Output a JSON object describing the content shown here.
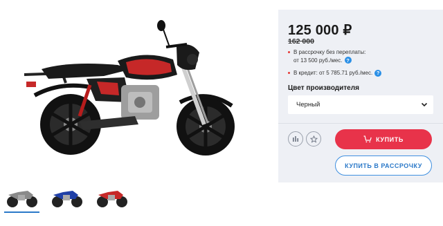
{
  "product": {
    "price": "125 000 ₽",
    "old_price": "162 000",
    "installment_line1": "В рассрочку без переплаты:",
    "installment_line2": "от 13 500 руб./мес.",
    "credit_text": "В кредит: от 5 785.71 руб./мес.",
    "help_symbol": "?",
    "color_label": "Цвет производителя",
    "color_selected": "Черный"
  },
  "actions": {
    "buy_label": "КУПИТЬ",
    "credit_label": "КУПИТЬ В РАССРОЧКУ",
    "compare_icon": "bar-chart-icon",
    "favorite_icon": "star-icon",
    "cart_icon": "cart-icon"
  },
  "gallery": {
    "main_image": "black-red-motorcycle",
    "thumbs": [
      {
        "image": "gray-motorcycle",
        "active": true
      },
      {
        "image": "blue-motorcycle",
        "active": false
      },
      {
        "image": "red-motorcycle",
        "active": false
      }
    ]
  },
  "colors": {
    "accent_red": "#e8334a",
    "accent_blue": "#2a8fe6",
    "panel_bg": "#eef0f5"
  }
}
